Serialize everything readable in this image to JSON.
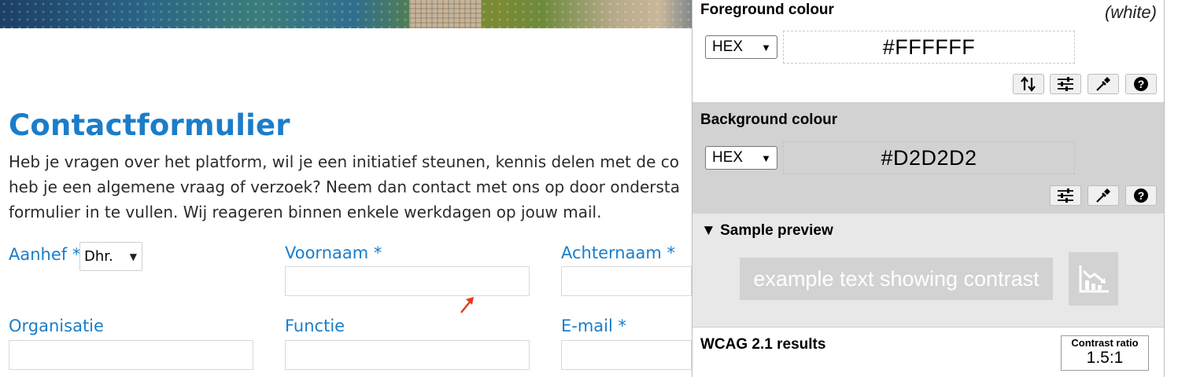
{
  "page": {
    "title": "Contactformulier",
    "intro_lines": [
      "Heb je vragen over het platform, wil je een initiatief steunen, kennis delen met de co",
      "heb je een algemene vraag of verzoek? Neem dan contact met ons op door ondersta",
      "formulier in te vullen. Wij reageren binnen enkele werkdagen op jouw mail."
    ],
    "form": {
      "salutation": {
        "label": "Aanhef",
        "required": "*",
        "value": "Dhr."
      },
      "first_name": {
        "label": "Voornaam",
        "required": "*"
      },
      "last_name": {
        "label": "Achternaam",
        "required": "*"
      },
      "organisation": {
        "label": "Organisatie"
      },
      "job_title": {
        "label": "Functie"
      },
      "email": {
        "label": "E-mail",
        "required": "*"
      }
    }
  },
  "contrast_panel": {
    "foreground": {
      "heading": "Foreground colour",
      "note": "(white)",
      "format": "HEX",
      "value": "#FFFFFF",
      "tools": [
        "swap-icon",
        "sliders-icon",
        "eyedropper-icon",
        "help-icon"
      ]
    },
    "background": {
      "heading": "Background colour",
      "format": "HEX",
      "value": "#D2D2D2",
      "tools": [
        "sliders-icon",
        "eyedropper-icon",
        "help-icon"
      ]
    },
    "sample": {
      "heading": "Sample preview",
      "toggle": "▼",
      "text": "example text showing contrast",
      "icon": "chart-icon"
    },
    "wcag": {
      "heading": "WCAG 2.1 results",
      "ratio_label": "Contrast ratio",
      "ratio_value": "1.5:1"
    },
    "colors": {
      "foreground": "#FFFFFF",
      "background": "#D2D2D2",
      "link_blue": "#1B7DC9"
    }
  }
}
